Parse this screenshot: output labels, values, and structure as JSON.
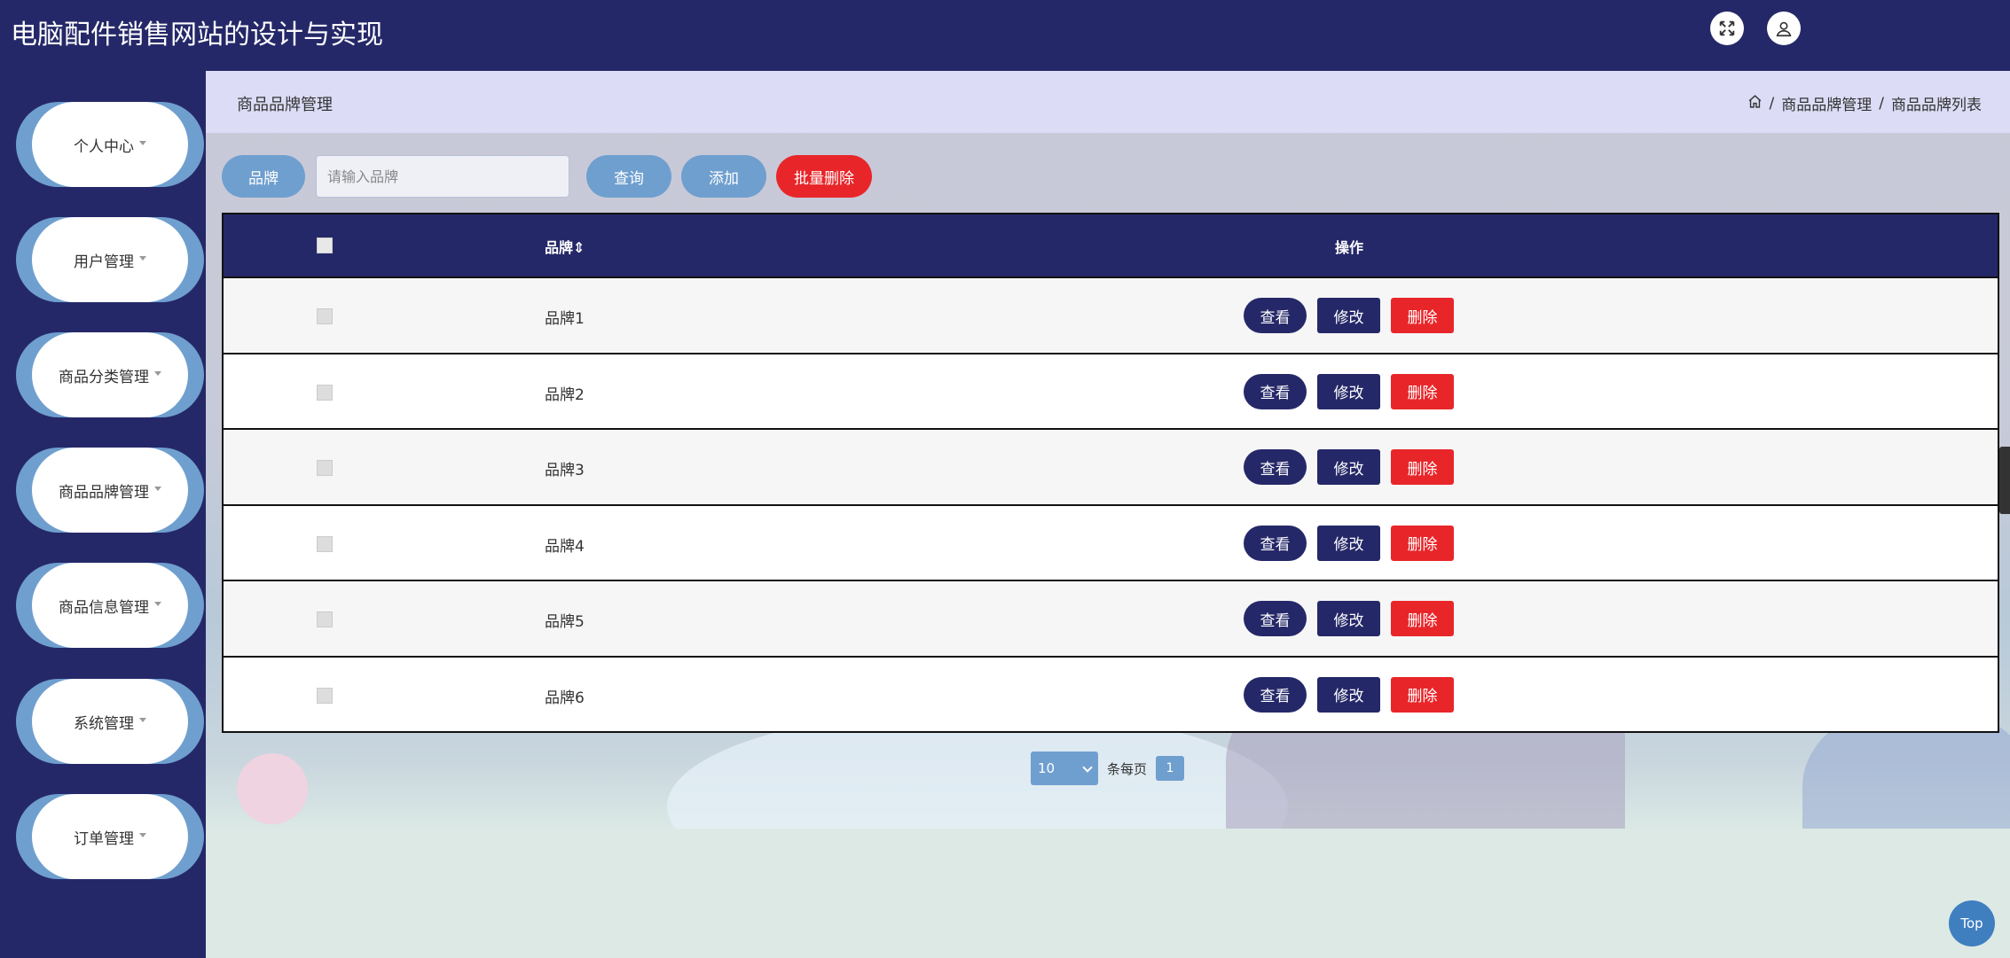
{
  "app": {
    "title": "电脑配件销售网站的设计与实现"
  },
  "topbar": {
    "fullscreen_icon": "fullscreen-icon",
    "user_icon": "user-icon"
  },
  "sidebar": {
    "items": [
      {
        "label": "个人中心"
      },
      {
        "label": "用户管理"
      },
      {
        "label": "商品分类管理"
      },
      {
        "label": "商品品牌管理"
      },
      {
        "label": "商品信息管理"
      },
      {
        "label": "系统管理"
      },
      {
        "label": "订单管理"
      }
    ]
  },
  "header": {
    "title": "商品品牌管理",
    "breadcrumb": [
      "商品品牌管理",
      "商品品牌列表"
    ],
    "separator": "/"
  },
  "search": {
    "label": "品牌",
    "placeholder": "请输入品牌",
    "query_label": "查询",
    "add_label": "添加",
    "batch_delete_label": "批量删除"
  },
  "table": {
    "columns": {
      "brand": "品牌",
      "ops": "操作"
    },
    "rows": [
      {
        "brand": "品牌1"
      },
      {
        "brand": "品牌2"
      },
      {
        "brand": "品牌3"
      },
      {
        "brand": "品牌4"
      },
      {
        "brand": "品牌5"
      },
      {
        "brand": "品牌6"
      }
    ],
    "actions": {
      "view": "查看",
      "edit": "修改",
      "delete": "删除"
    }
  },
  "pagination": {
    "page_size": "10",
    "per_page_label": "条每页",
    "current_page": "1"
  },
  "back_to_top": "Top",
  "colors": {
    "primary": "#252868",
    "accent": "#6f9fcf",
    "danger": "#e8262a"
  }
}
